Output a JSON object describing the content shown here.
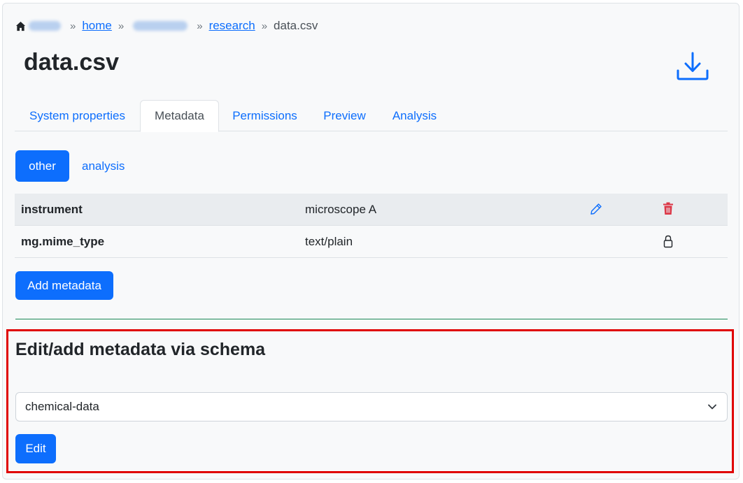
{
  "breadcrumb": {
    "home_link": "home",
    "research_link": "research",
    "current": "data.csv",
    "separator": "»"
  },
  "page": {
    "title": "data.csv"
  },
  "tabs": [
    {
      "label": "System properties"
    },
    {
      "label": "Metadata"
    },
    {
      "label": "Permissions"
    },
    {
      "label": "Preview"
    },
    {
      "label": "Analysis"
    }
  ],
  "pills": {
    "active": "other",
    "inactive": "analysis"
  },
  "metadata": [
    {
      "key": "instrument",
      "value": "microscope A"
    },
    {
      "key": "mg.mime_type",
      "value": "text/plain"
    }
  ],
  "buttons": {
    "add_metadata": "Add metadata",
    "edit": "Edit"
  },
  "schema": {
    "heading": "Edit/add metadata via schema",
    "selected": "chemical-data"
  },
  "colors": {
    "primary": "#0d6efd",
    "danger": "#dc3545",
    "divider": "#198754",
    "highlight": "#e00000"
  }
}
